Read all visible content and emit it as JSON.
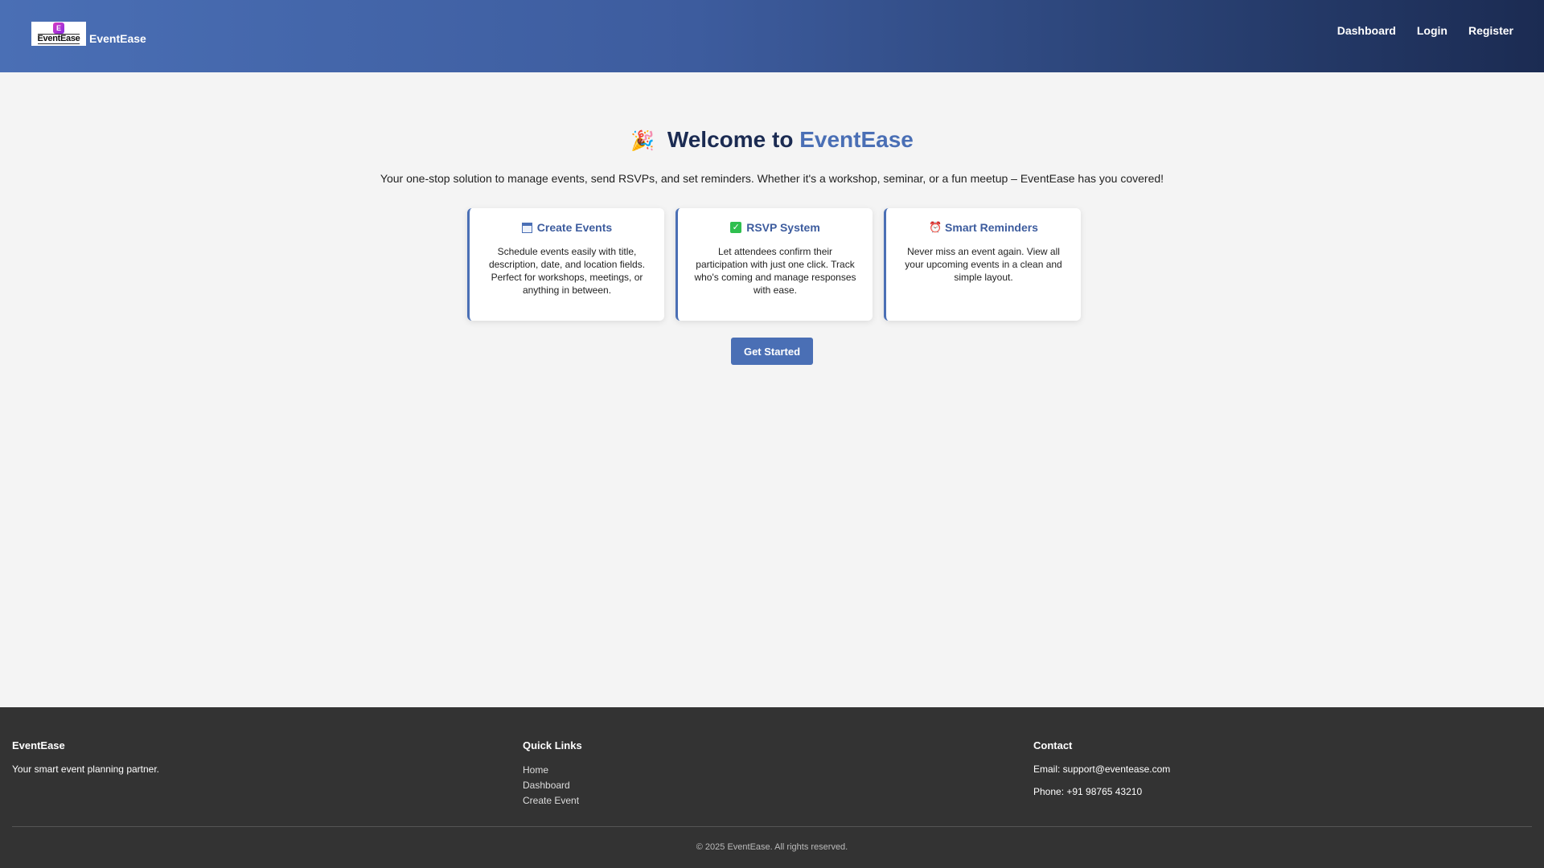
{
  "header": {
    "logo_text": "EventEase",
    "brand_name": "EventEase",
    "nav": [
      "Dashboard",
      "Login",
      "Register"
    ]
  },
  "hero": {
    "emoji": "🎉",
    "title_prefix": "Welcome to",
    "title_accent": "EventEase",
    "subtitle": "Your one-stop solution to manage events, send RSVPs, and set reminders. Whether it's a workshop, seminar, or a fun meetup – EventEase has you covered!"
  },
  "cards": [
    {
      "icon": "calendar-icon",
      "title": "Create Events",
      "body": "Schedule events easily with title, description, date, and location fields. Perfect for workshops, meetings, or anything in between."
    },
    {
      "icon": "checkbox-icon",
      "title": "RSVP System",
      "body": "Let attendees confirm their participation with just one click. Track who's coming and manage responses with ease."
    },
    {
      "icon": "alarm-clock-icon",
      "title": "Smart Reminders",
      "body": "Never miss an event again. View all your upcoming events in a clean and simple layout."
    }
  ],
  "cta": {
    "label": "Get Started"
  },
  "footer": {
    "about": {
      "title": "EventEase",
      "text": "Your smart event planning partner."
    },
    "quick_links": {
      "title": "Quick Links",
      "links": [
        "Home",
        "Dashboard",
        "Create Event"
      ]
    },
    "contact": {
      "title": "Contact",
      "email": "Email: support@eventease.com",
      "phone": "Phone: +91 98765 43210"
    },
    "copyright": "© 2025 EventEase. All rights reserved."
  },
  "colors": {
    "accent": "#4a6fb5",
    "dark_navy": "#1b2b52",
    "footer_bg": "#333333"
  }
}
